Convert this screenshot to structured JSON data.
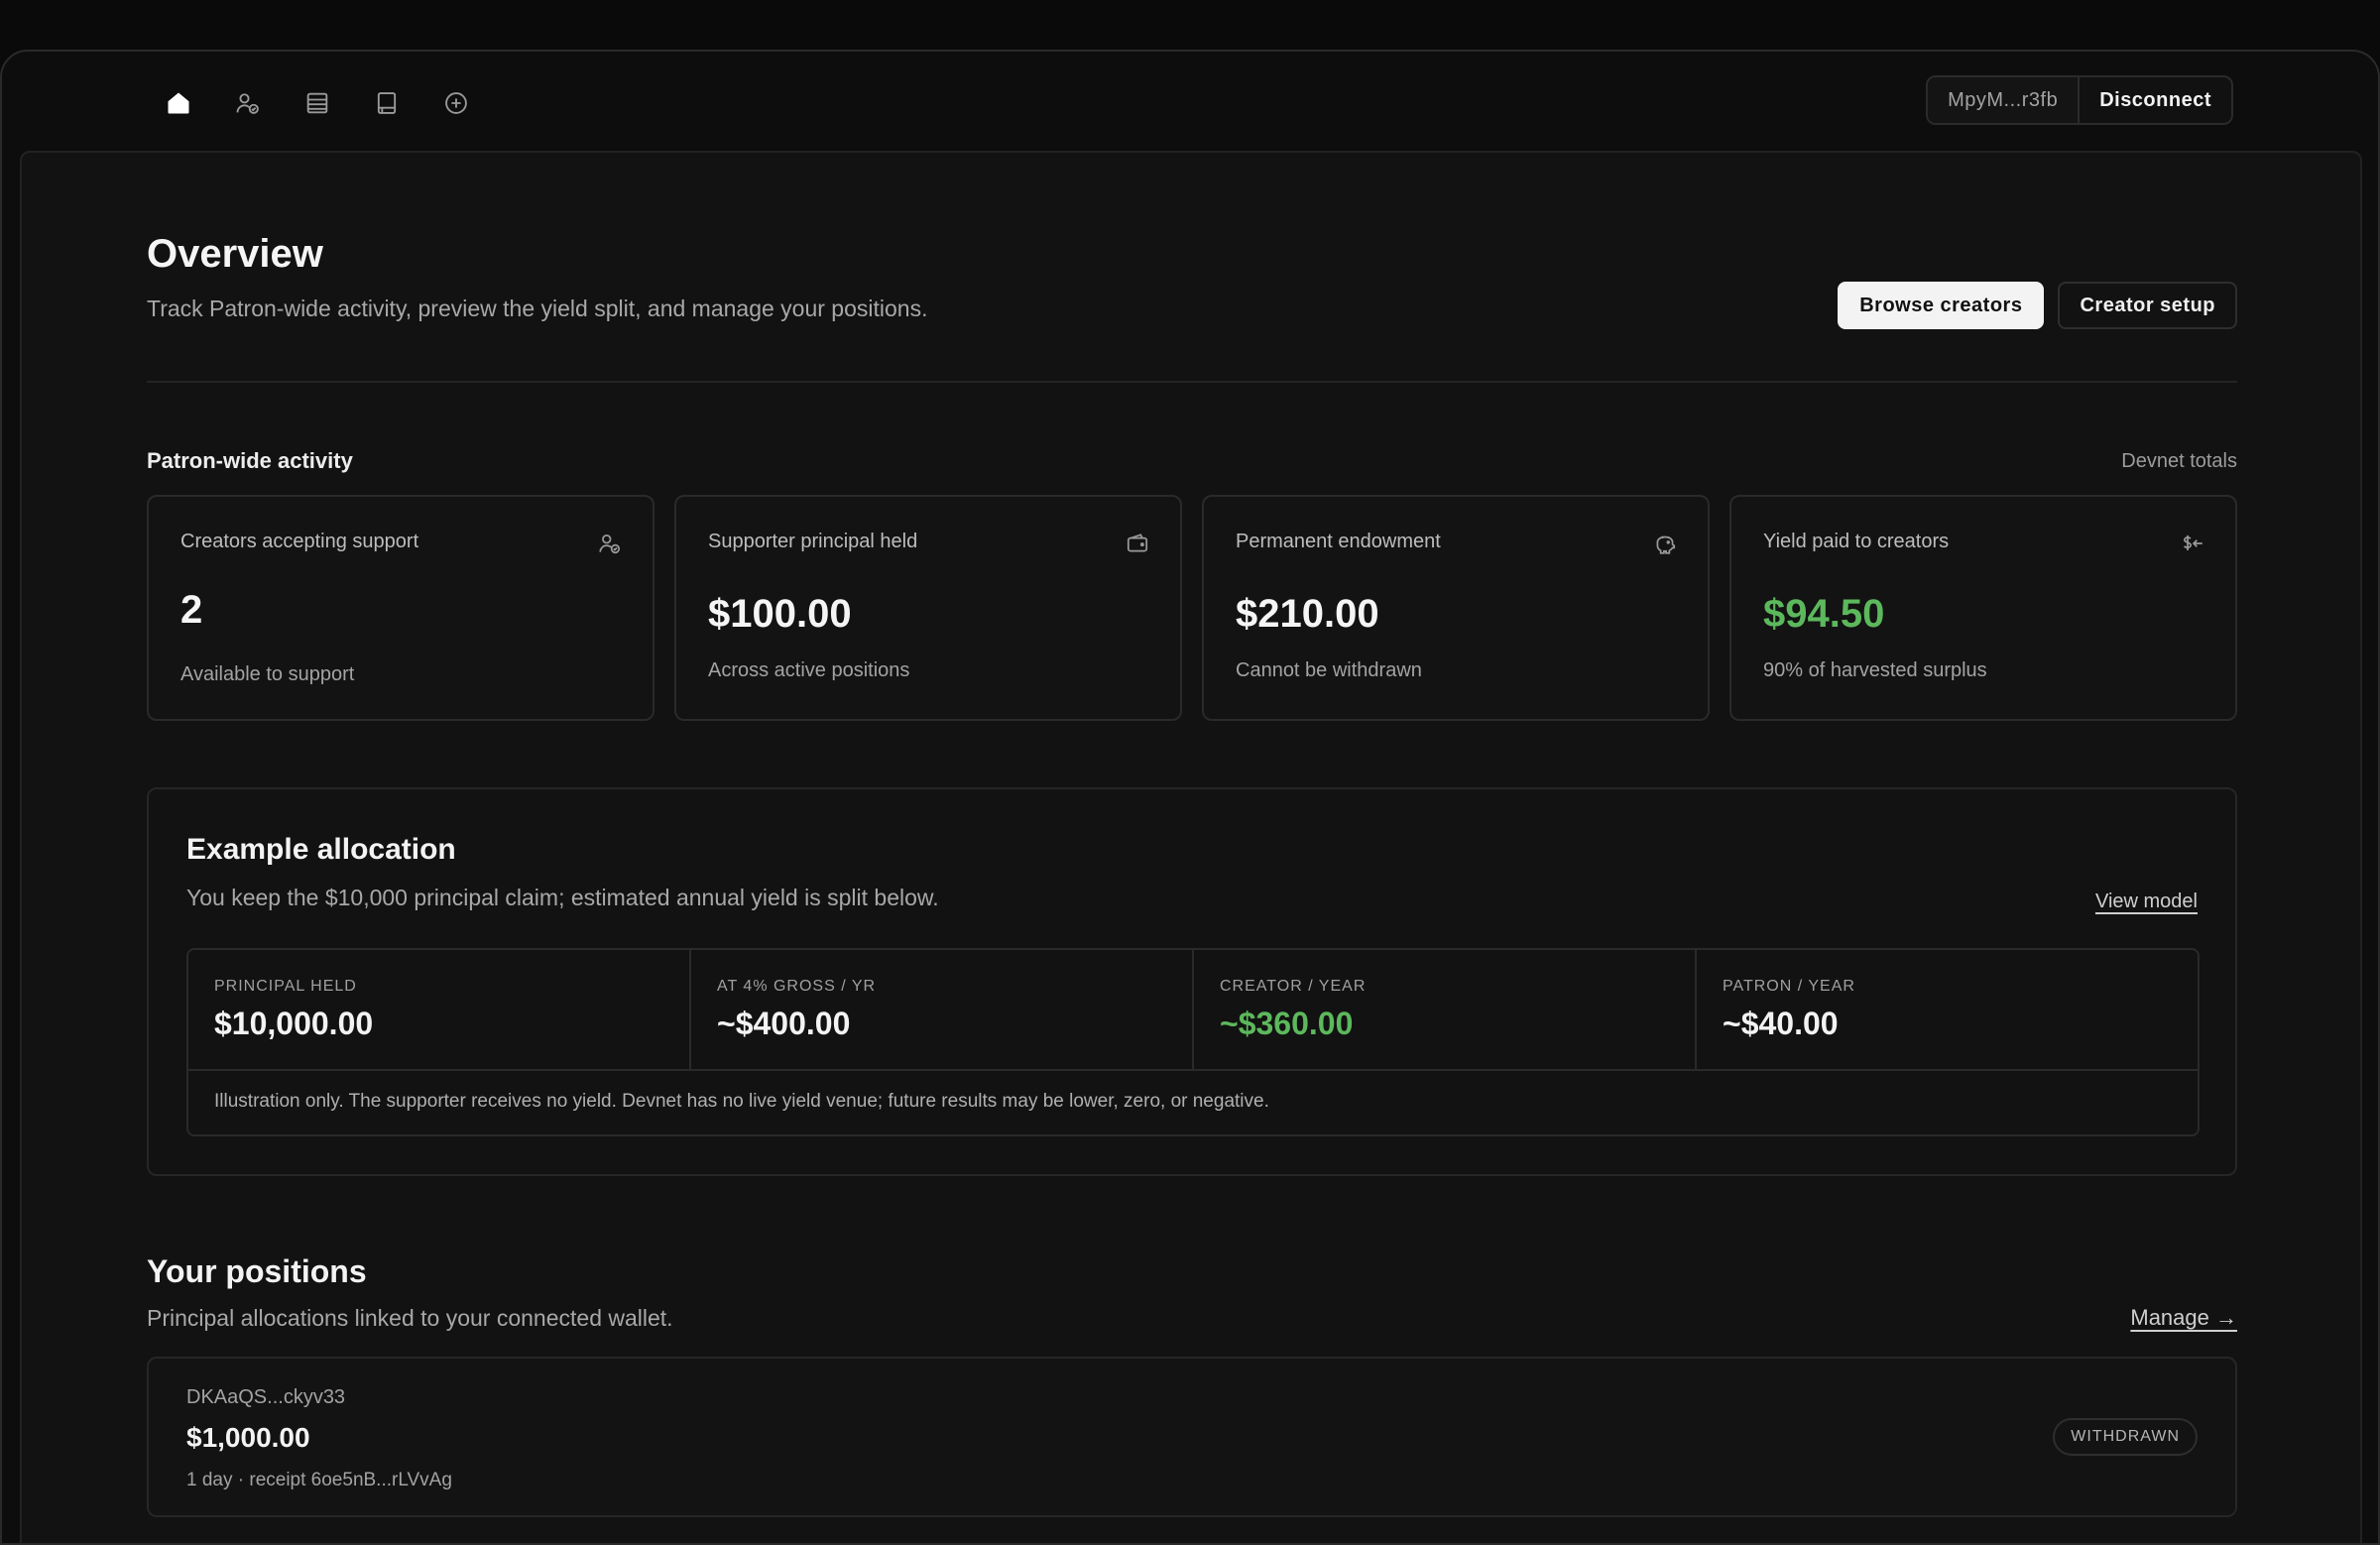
{
  "nav": {
    "items": [
      {
        "icon": "home-icon",
        "active": true
      },
      {
        "icon": "users-icon",
        "active": false
      },
      {
        "icon": "list-icon",
        "active": false
      },
      {
        "icon": "book-icon",
        "active": false
      },
      {
        "icon": "plus-circle-icon",
        "active": false
      }
    ]
  },
  "wallet": {
    "address": "MpyM...r3fb",
    "disconnect_label": "Disconnect"
  },
  "header": {
    "title": "Overview",
    "subtitle": "Track Patron-wide activity, preview the yield split, and manage your positions.",
    "browse_label": "Browse creators",
    "setup_label": "Creator setup"
  },
  "activity": {
    "title": "Patron-wide activity",
    "right_label": "Devnet totals",
    "cards": [
      {
        "label": "Creators accepting support",
        "value": "2",
        "note": "Available to support",
        "icon": "user-check-icon",
        "color": "#f5f5f5"
      },
      {
        "label": "Supporter principal held",
        "value": "$100.00",
        "note": "Across active positions",
        "icon": "wallet-icon",
        "color": "#f5f5f5"
      },
      {
        "label": "Permanent endowment",
        "value": "$210.00",
        "note": "Cannot be withdrawn",
        "icon": "piggy-bank-icon",
        "color": "#f5f5f5"
      },
      {
        "label": "Yield paid to creators",
        "value": "$94.50",
        "note": "90% of harvested surplus",
        "icon": "dollar-arrow-icon",
        "color": "#5cb85c"
      }
    ]
  },
  "allocation": {
    "title": "Example allocation",
    "subtitle": "You keep the $10,000 principal claim; estimated annual yield is split below.",
    "link_label": "View model",
    "cells": [
      {
        "label": "PRINCIPAL HELD",
        "value": "$10,000.00"
      },
      {
        "label": "AT 4% GROSS / YR",
        "value": "~$400.00"
      },
      {
        "label": "CREATOR / YEAR",
        "value": "~$360.00"
      },
      {
        "label": "PATRON / YEAR",
        "value": "~$40.00"
      }
    ],
    "note": "Illustration only. The supporter receives no yield. Devnet has no live yield venue; future results may be lower, zero, or negative."
  },
  "positions": {
    "title": "Your positions",
    "subtitle": "Principal allocations linked to your connected wallet.",
    "link_label": "Manage →",
    "items": [
      {
        "id": "DKAaQS...ckyv33",
        "amount": "$1,000.00",
        "meta": "1 day · receipt 6oe5nB...rLVvAg",
        "status": "WITHDRAWN"
      }
    ]
  },
  "colors": {
    "accent_green": "#5cb85c",
    "background": "#121212"
  }
}
